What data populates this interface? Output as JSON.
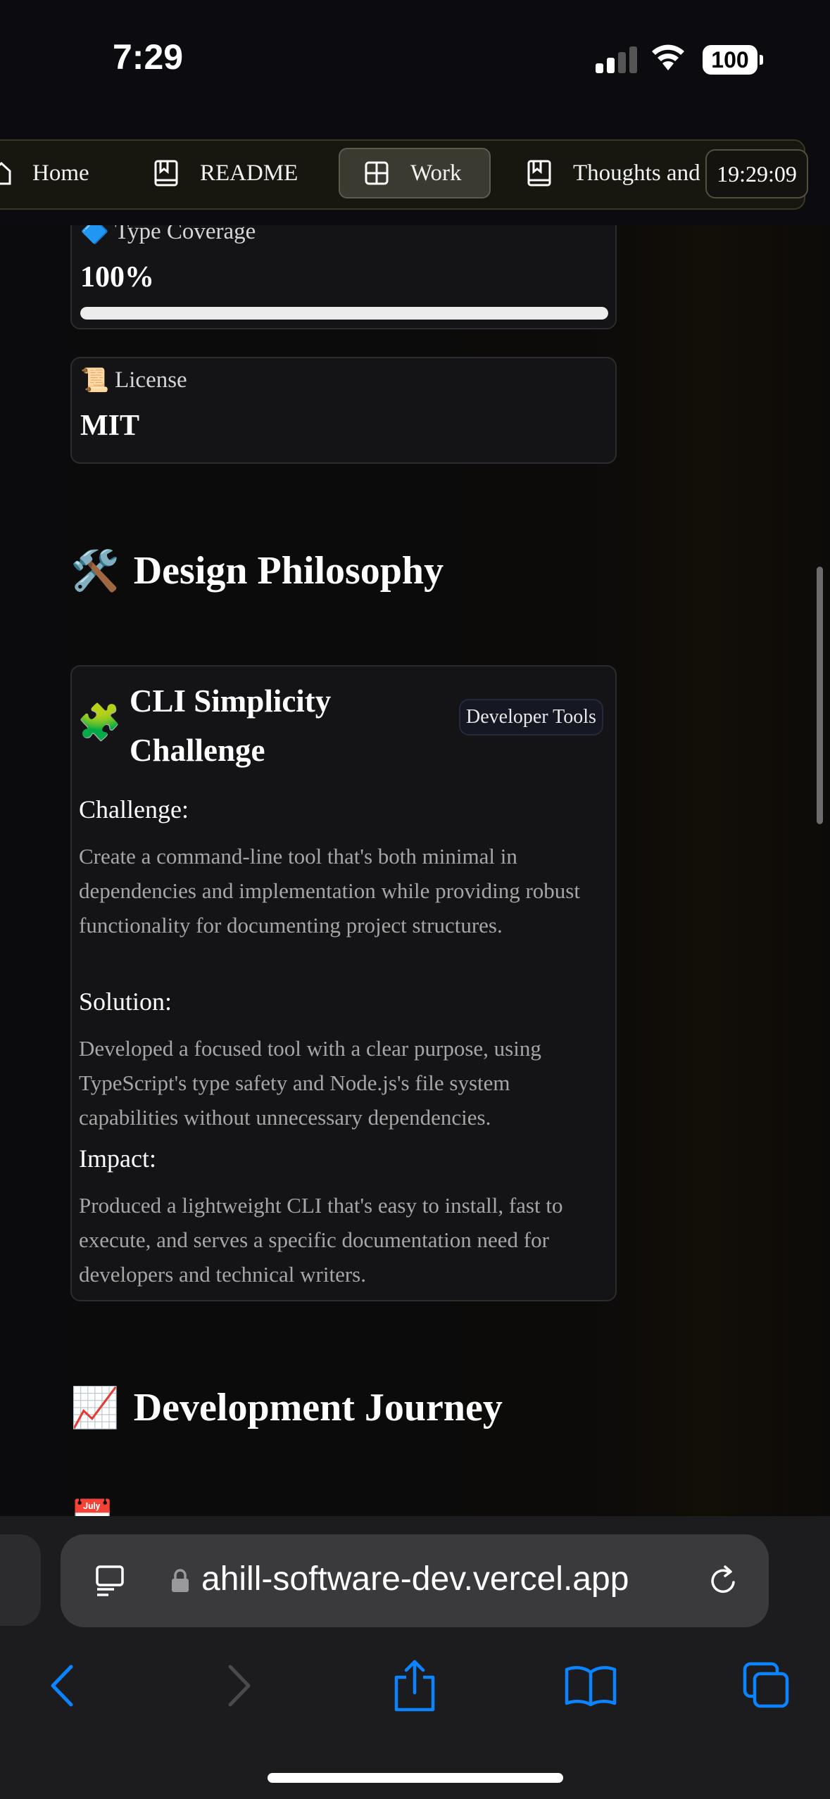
{
  "status_bar": {
    "time": "7:29",
    "battery": "100"
  },
  "nav": {
    "items": [
      {
        "label": "Home",
        "icon": "home-icon"
      },
      {
        "label": "README",
        "icon": "book-icon"
      },
      {
        "label": "Work",
        "icon": "grid-icon",
        "active": true
      },
      {
        "label": "Thoughts and",
        "icon": "book-icon"
      }
    ],
    "clock": "19:29:09"
  },
  "metrics": [
    {
      "emoji": "🔷",
      "label": "Type Coverage",
      "value": "100%",
      "progress": 1.0
    },
    {
      "emoji": "📜",
      "label": "License",
      "value": "MIT"
    }
  ],
  "design_philosophy": {
    "emoji": "🛠️",
    "heading": "Design Philosophy",
    "card": {
      "emoji": "🧩",
      "title": "CLI Simplicity Challenge",
      "tag": "Developer Tools",
      "challenge_label": "Challenge:",
      "challenge_text": "Create a command-line tool that's both minimal in dependencies and implementation while providing robust functionality for documenting project structures.",
      "solution_label": "Solution:",
      "solution_text": "Developed a focused tool with a clear purpose, using TypeScript's type safety and Node.js's file system capabilities without unnecessary dependencies.",
      "impact_label": "Impact:",
      "impact_text": "Produced a lightweight CLI that's easy to install, fast to execute, and serves a specific documentation need for developers and technical writers."
    }
  },
  "development_journey": {
    "emoji": "📈",
    "heading": "Development Journey",
    "next_emoji": "📅"
  },
  "browser": {
    "url": "ahill-software-dev.vercel.app"
  },
  "colors": {
    "accent": "#0a84ff",
    "background": "#0a0a0c"
  }
}
